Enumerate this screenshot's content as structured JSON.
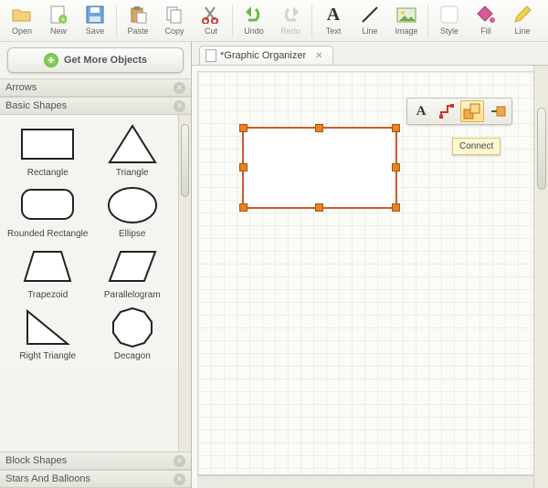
{
  "toolbar": {
    "items": [
      {
        "label": "Open",
        "icon": "folder-icon"
      },
      {
        "label": "New",
        "icon": "new-doc-icon"
      },
      {
        "label": "Save",
        "icon": "save-icon"
      },
      null,
      {
        "label": "Paste",
        "icon": "paste-icon"
      },
      {
        "label": "Copy",
        "icon": "copy-icon"
      },
      {
        "label": "Cut",
        "icon": "cut-icon"
      },
      null,
      {
        "label": "Undo",
        "icon": "undo-icon"
      },
      {
        "label": "Redo",
        "icon": "redo-icon",
        "disabled": true
      },
      null,
      {
        "label": "Text",
        "icon": "text-icon"
      },
      {
        "label": "Line",
        "icon": "line-icon"
      },
      {
        "label": "Image",
        "icon": "image-icon"
      },
      null,
      {
        "label": "Style",
        "icon": "style-icon"
      },
      {
        "label": "Fill",
        "icon": "fill-icon"
      },
      {
        "label": "Line",
        "icon": "line2-icon"
      }
    ]
  },
  "sidebar": {
    "get_more_label": "Get More Objects",
    "sections": {
      "arrows": "Arrows",
      "basic_shapes": "Basic Shapes",
      "block_shapes": "Block Shapes",
      "stars_balloons": "Stars And Balloons"
    },
    "shapes": [
      {
        "name": "Rectangle"
      },
      {
        "name": "Triangle"
      },
      {
        "name": "Rounded Rectangle"
      },
      {
        "name": "Ellipse"
      },
      {
        "name": "Trapezoid"
      },
      {
        "name": "Parallelogram"
      },
      {
        "name": "Right Triangle"
      },
      {
        "name": "Decagon"
      }
    ]
  },
  "tab": {
    "title": "*Graphic Organizer"
  },
  "float_toolbar": {
    "tooltip": "Connect",
    "buttons": [
      "add-text-icon",
      "connector-icon",
      "connect-icon",
      "shape-fill-icon"
    ]
  },
  "colors": {
    "selection": "#cc5a2a",
    "handle": "#e48423"
  }
}
